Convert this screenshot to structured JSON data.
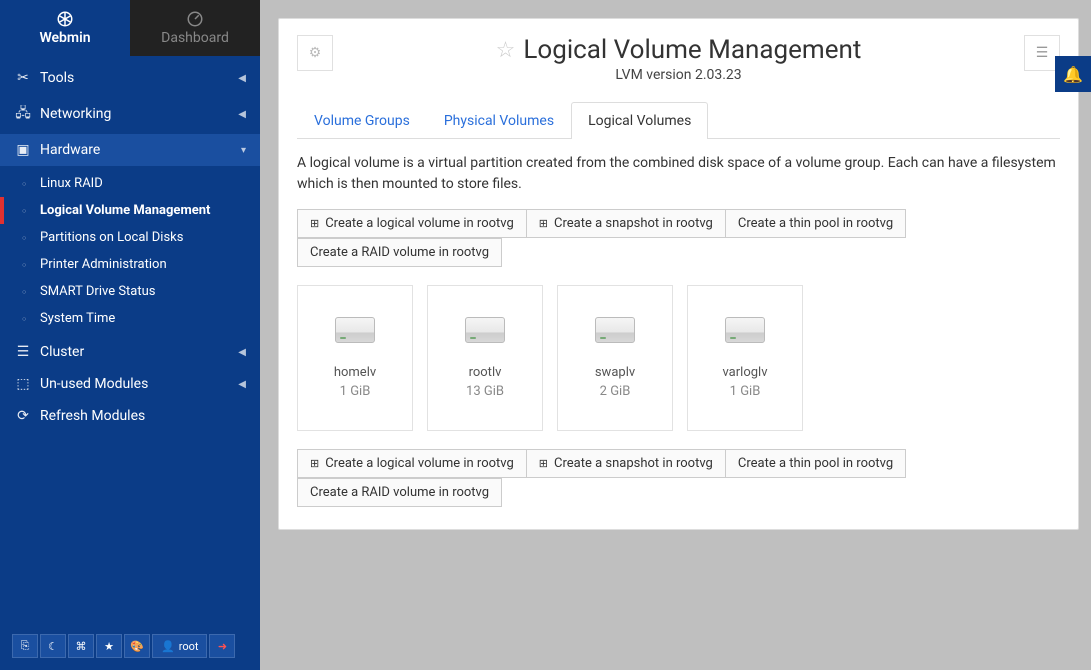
{
  "sidebar": {
    "tabs": {
      "webmin": "Webmin",
      "dashboard": "Dashboard"
    },
    "items": [
      {
        "label": "Tools"
      },
      {
        "label": "Networking"
      },
      {
        "label": "Hardware"
      },
      {
        "label": "Cluster"
      },
      {
        "label": "Un-used Modules"
      },
      {
        "label": "Refresh Modules"
      }
    ],
    "hardware_sub": [
      {
        "label": "Linux RAID"
      },
      {
        "label": "Logical Volume Management"
      },
      {
        "label": "Partitions on Local Disks"
      },
      {
        "label": "Printer Administration"
      },
      {
        "label": "SMART Drive Status"
      },
      {
        "label": "System Time"
      }
    ],
    "user": "root"
  },
  "page": {
    "title": "Logical Volume Management",
    "subtitle": "LVM version 2.03.23",
    "tabs": [
      {
        "label": "Volume Groups"
      },
      {
        "label": "Physical Volumes"
      },
      {
        "label": "Logical Volumes"
      }
    ],
    "description": "A logical volume is a virtual partition created from the combined disk space of a volume group. Each can have a filesystem which is then mounted to store files.",
    "actions": [
      {
        "label": "Create a logical volume in rootvg",
        "plus": true
      },
      {
        "label": "Create a snapshot in rootvg",
        "plus": true
      },
      {
        "label": "Create a thin pool in rootvg",
        "plus": false
      },
      {
        "label": "Create a RAID volume in rootvg",
        "plus": false
      }
    ],
    "volumes": [
      {
        "name": "homelv",
        "size": "1 GiB"
      },
      {
        "name": "rootlv",
        "size": "13 GiB"
      },
      {
        "name": "swaplv",
        "size": "2 GiB"
      },
      {
        "name": "varloglv",
        "size": "1 GiB"
      }
    ]
  }
}
